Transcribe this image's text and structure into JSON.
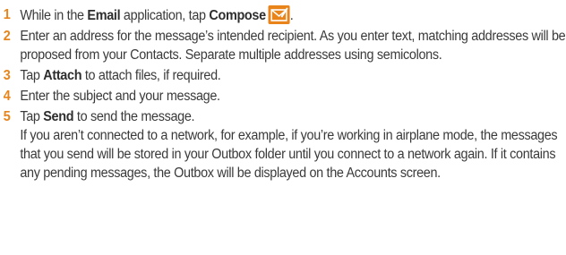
{
  "steps": [
    {
      "number": "1",
      "parts": {
        "t1": "While in the ",
        "b1": "Email",
        "t2": " application, tap ",
        "b2": "Compose",
        "t3": "."
      },
      "icon": "compose-email-icon"
    },
    {
      "number": "2",
      "parts": {
        "t1": "Enter an address for the message’s intended recipient. As you enter text, matching addresses will be proposed from your Contacts. Separate multiple addresses using semicolons."
      }
    },
    {
      "number": "3",
      "parts": {
        "t1": "Tap ",
        "b1": "Attach",
        "t2": " to attach files, if required."
      }
    },
    {
      "number": "4",
      "parts": {
        "t1": "Enter the subject and your message."
      }
    },
    {
      "number": "5",
      "parts": {
        "t1": "Tap ",
        "b1": "Send",
        "t2": " to send the message."
      },
      "note": "If you aren’t connected to a network, for example, if you’re working in airplane mode, the messages that you send will be stored in your Outbox folder until you connect to a network again. If it contains any pending messages, the Outbox will be displayed on the Accounts screen."
    }
  ],
  "colors": {
    "step_number": "#e8841a",
    "icon_background": "#e8841a",
    "text": "#3a3a3a"
  }
}
